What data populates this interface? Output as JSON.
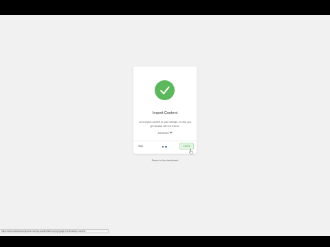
{
  "wizard": {
    "title": "Import Content",
    "description": "Let's import content to your website, to help you get familiar with the theme.",
    "advanced_label": "Advanced",
    "skip_label": "Skip",
    "progress_label": "100%",
    "progress_fraction": 1.0,
    "steps_total": 2,
    "colors": {
      "success": "#5cb85c",
      "progress_bg": "#e2f3e2",
      "progress_text": "#4aa64a",
      "dot_active": "#1f6fa5"
    },
    "icon": "checkmark-icon"
  },
  "return_link": "Return to the dashboard",
  "status_bar": {
    "url": "https://demo.fastest.wordpress.com/wp-admin/themes.php?page=merlin&step=content"
  }
}
